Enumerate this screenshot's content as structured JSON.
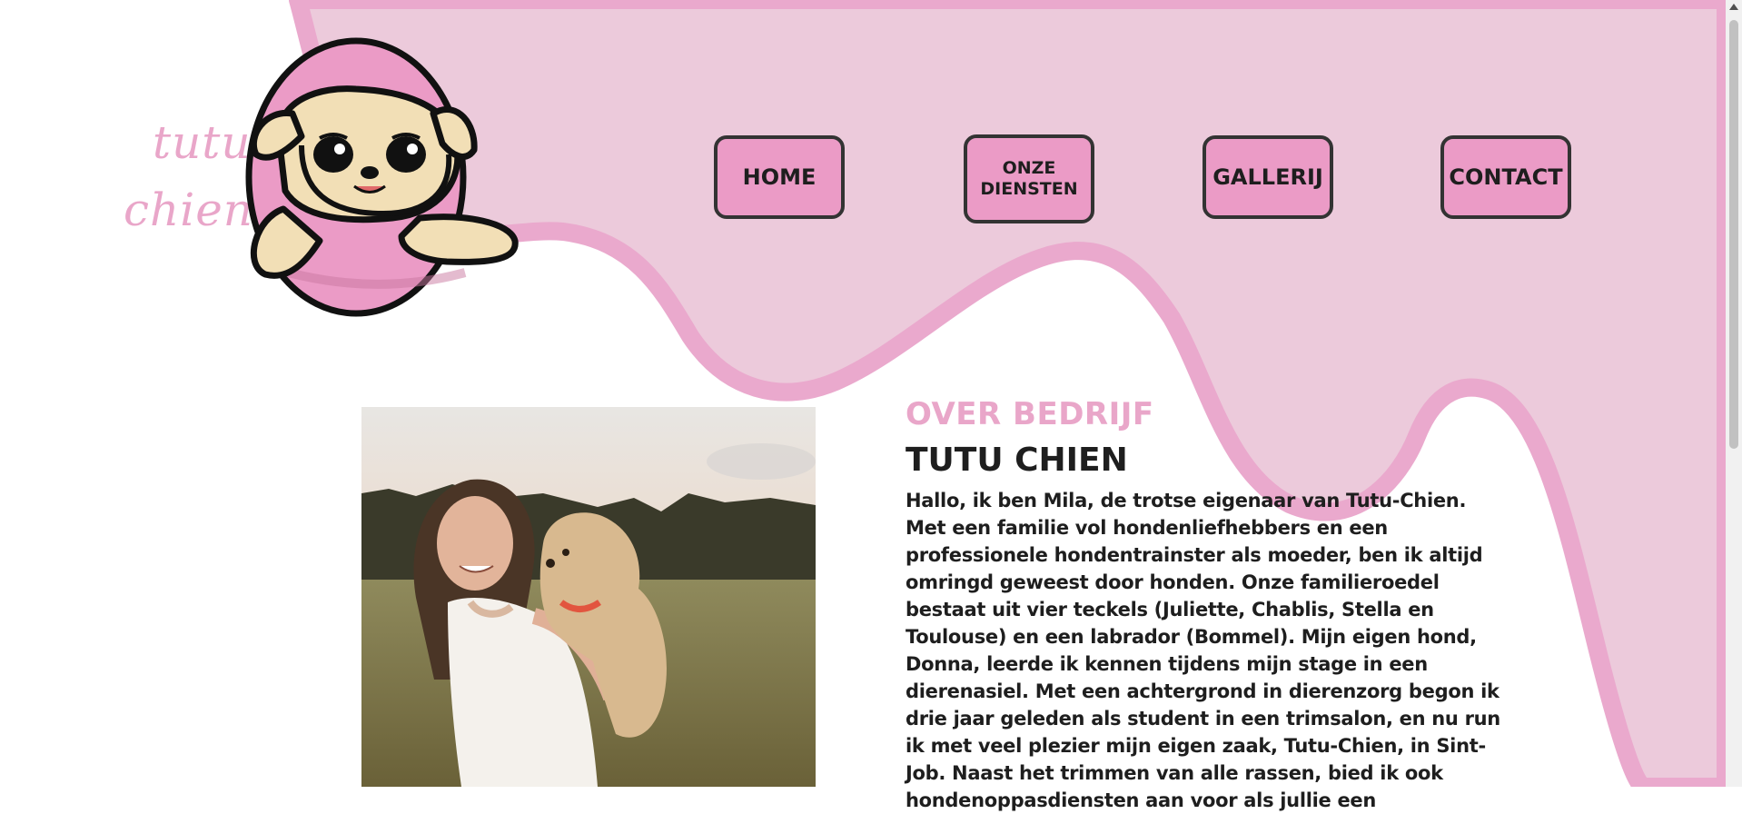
{
  "brand": {
    "logo_line1": "tutu",
    "logo_line2": "chien"
  },
  "nav": {
    "home": "HOME",
    "diensten_line1": "ONZE",
    "diensten_line2": "DIENSTEN",
    "galerij": "GALLERIJ",
    "contact": "CONTACT"
  },
  "about": {
    "label": "OVER BEDRIJF",
    "title": "TUTU CHIEN",
    "text": "Hallo, ik ben Mila, de trotse eigenaar van Tutu-Chien. Met een familie vol hondenliefhebbers en een professionele hondentrainster als moeder, ben ik altijd omringd geweest door honden. Onze familieroedel bestaat uit vier teckels (Juliette, Chablis, Stella en Toulouse) en een labrador (Bommel). Mijn eigen hond, Donna, leerde ik kennen tijdens mijn stage in een dierenasiel. Met een achtergrond in dierenzorg begon ik drie jaar geleden als student in een trimsalon, en nu run ik met veel plezier mijn eigen zaak, Tutu-Chien, in Sint-Job. Naast het trimmen van alle rassen, bied ik ook hondenoppasdiensten aan voor als jullie een"
  },
  "colors": {
    "header_bg": "#eccadb",
    "wave_stroke": "#eaa9cd",
    "button_pink": "#eb9bc6",
    "accent_pink": "#e9a6c9",
    "text_dark": "#1e1e1e"
  },
  "icons": {
    "logo": "puppy-logo-icon",
    "scroll": "scroll-up-arrow-icon"
  }
}
